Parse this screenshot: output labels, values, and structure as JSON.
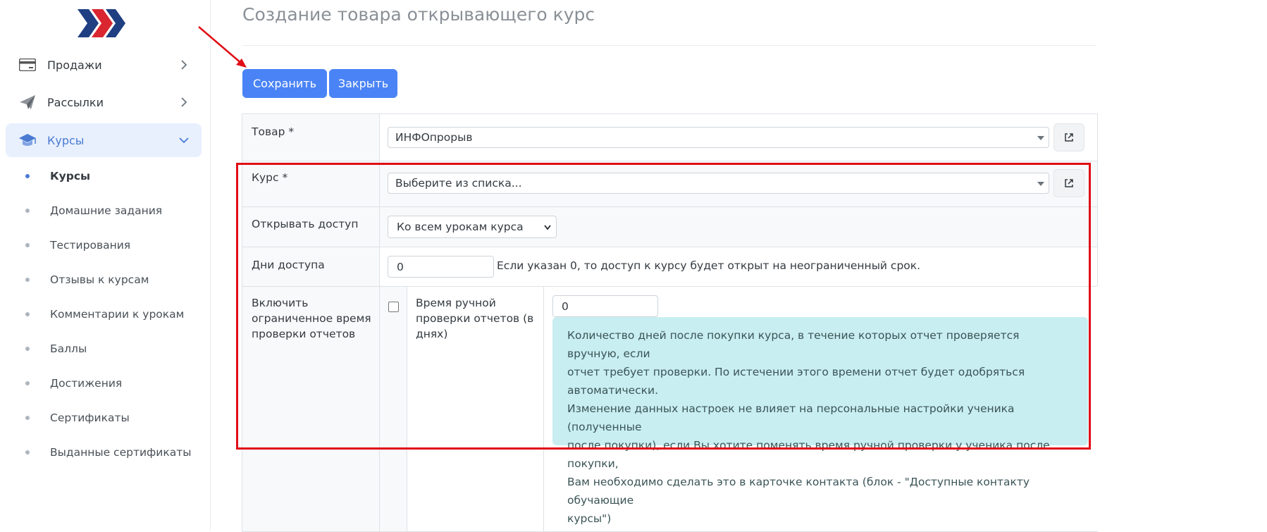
{
  "sidebar": {
    "items": [
      {
        "label": "Продажи",
        "icon": "credit-card-icon"
      },
      {
        "label": "Рассылки",
        "icon": "paper-plane-icon"
      },
      {
        "label": "Курсы",
        "icon": "graduation-cap-icon"
      }
    ],
    "subitems": [
      {
        "label": "Курсы"
      },
      {
        "label": "Домашние задания"
      },
      {
        "label": "Тестирования"
      },
      {
        "label": "Отзывы к курсам"
      },
      {
        "label": "Комментарии к урокам"
      },
      {
        "label": "Баллы"
      },
      {
        "label": "Достижения"
      },
      {
        "label": "Сертификаты"
      },
      {
        "label": "Выданные сертификаты"
      }
    ]
  },
  "page": {
    "title": "Создание товара открывающего курс"
  },
  "toolbar": {
    "save_label": "Сохранить",
    "close_label": "Закрыть"
  },
  "form": {
    "product": {
      "label": "Товар *",
      "value": "ИНФОпрорыв"
    },
    "course": {
      "label": "Курс *",
      "placeholder": "Выберите из списка..."
    },
    "open_access": {
      "label": "Открывать доступ",
      "value": "Ко всем урокам курса"
    },
    "access_days": {
      "label": "Дни доступа",
      "value": "0",
      "help": "Если указан 0, то доступ к курсу будет открыт на неограниченный срок."
    },
    "limited_check": {
      "label_lines": [
        "Включить",
        "ограниченное время",
        "проверки отчетов"
      ],
      "checked": false
    },
    "manual_check_time": {
      "label_lines": [
        "Время ручной",
        "проверки отчетов (в",
        "днях)"
      ],
      "value": "0"
    },
    "info_lines": [
      "Количество дней после покупки курса, в течение которых отчет проверяется вручную, если",
      "отчет требует проверки. По истечении этого времени отчет будет одобряться автоматически.",
      "Изменение данных настроек не влияет на персональные настройки ученика (полученные",
      "после покупки), если Вы хотите поменять время ручной проверки у ученика после покупки,",
      "Вам необходимо сделать это в карточке контакта (блок - \"Доступные контакту обучающие",
      "курсы\")"
    ]
  },
  "colors": {
    "accent": "#4a83f5",
    "highlight": "#e00d16",
    "info_bg": "#c8eef1",
    "nav_active_bg": "#e8f0fe"
  }
}
